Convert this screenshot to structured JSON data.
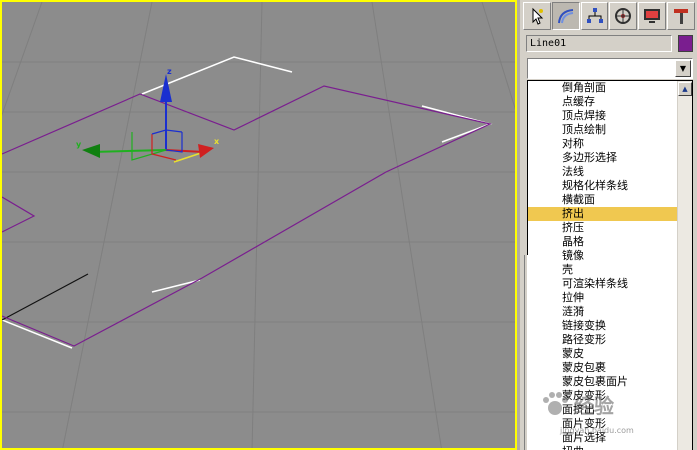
{
  "viewport": {
    "axes": {
      "x": "x",
      "y": "y",
      "z": "z"
    }
  },
  "command_panel": {
    "tabs": [
      {
        "icon": "create-arrow-icon"
      },
      {
        "icon": "modify-arc-icon",
        "active": true
      },
      {
        "icon": "hierarchy-icon"
      },
      {
        "icon": "motion-wheel-icon"
      },
      {
        "icon": "display-monitor-icon"
      },
      {
        "icon": "utilities-hammer-icon"
      }
    ],
    "object_name": "Line01",
    "object_color": "#7a1e8f",
    "modifier_dropdown_value": "",
    "modifier_list": {
      "items": [
        "倒角剖面",
        "点缓存",
        "顶点焊接",
        "顶点绘制",
        "对称",
        "多边形选择",
        "法线",
        "规格化样条线",
        "横截面",
        "挤出",
        "挤压",
        "晶格",
        "镜像",
        "壳",
        "可渲染样条线",
        "拉伸",
        "涟漪",
        "链接变换",
        "路径变形",
        "蒙皮",
        "蒙皮包裹",
        "蒙皮包裹面片",
        "蒙皮变形",
        "面挤出",
        "面片变形",
        "面片选择",
        "扭曲"
      ],
      "selected_index": 9
    }
  },
  "watermark": {
    "text": "经验",
    "url": "jingyan.baidu.com"
  }
}
